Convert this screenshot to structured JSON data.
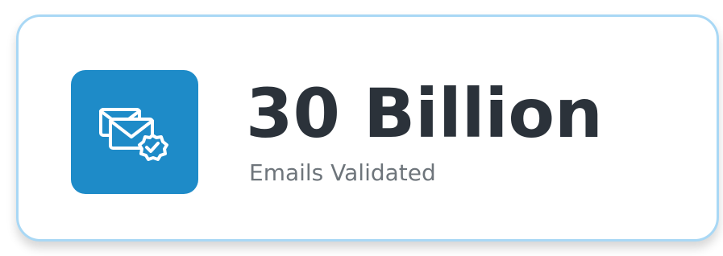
{
  "stat_card": {
    "value": "30 Billion",
    "label": "Emails Validated",
    "icon": "email-verified-icon"
  },
  "colors": {
    "card_border": "#a9d8f5",
    "icon_tile": "#1e8bc8",
    "value_text": "#2b323a",
    "label_text": "#6e757b",
    "icon_glyph": "#ffffff"
  }
}
